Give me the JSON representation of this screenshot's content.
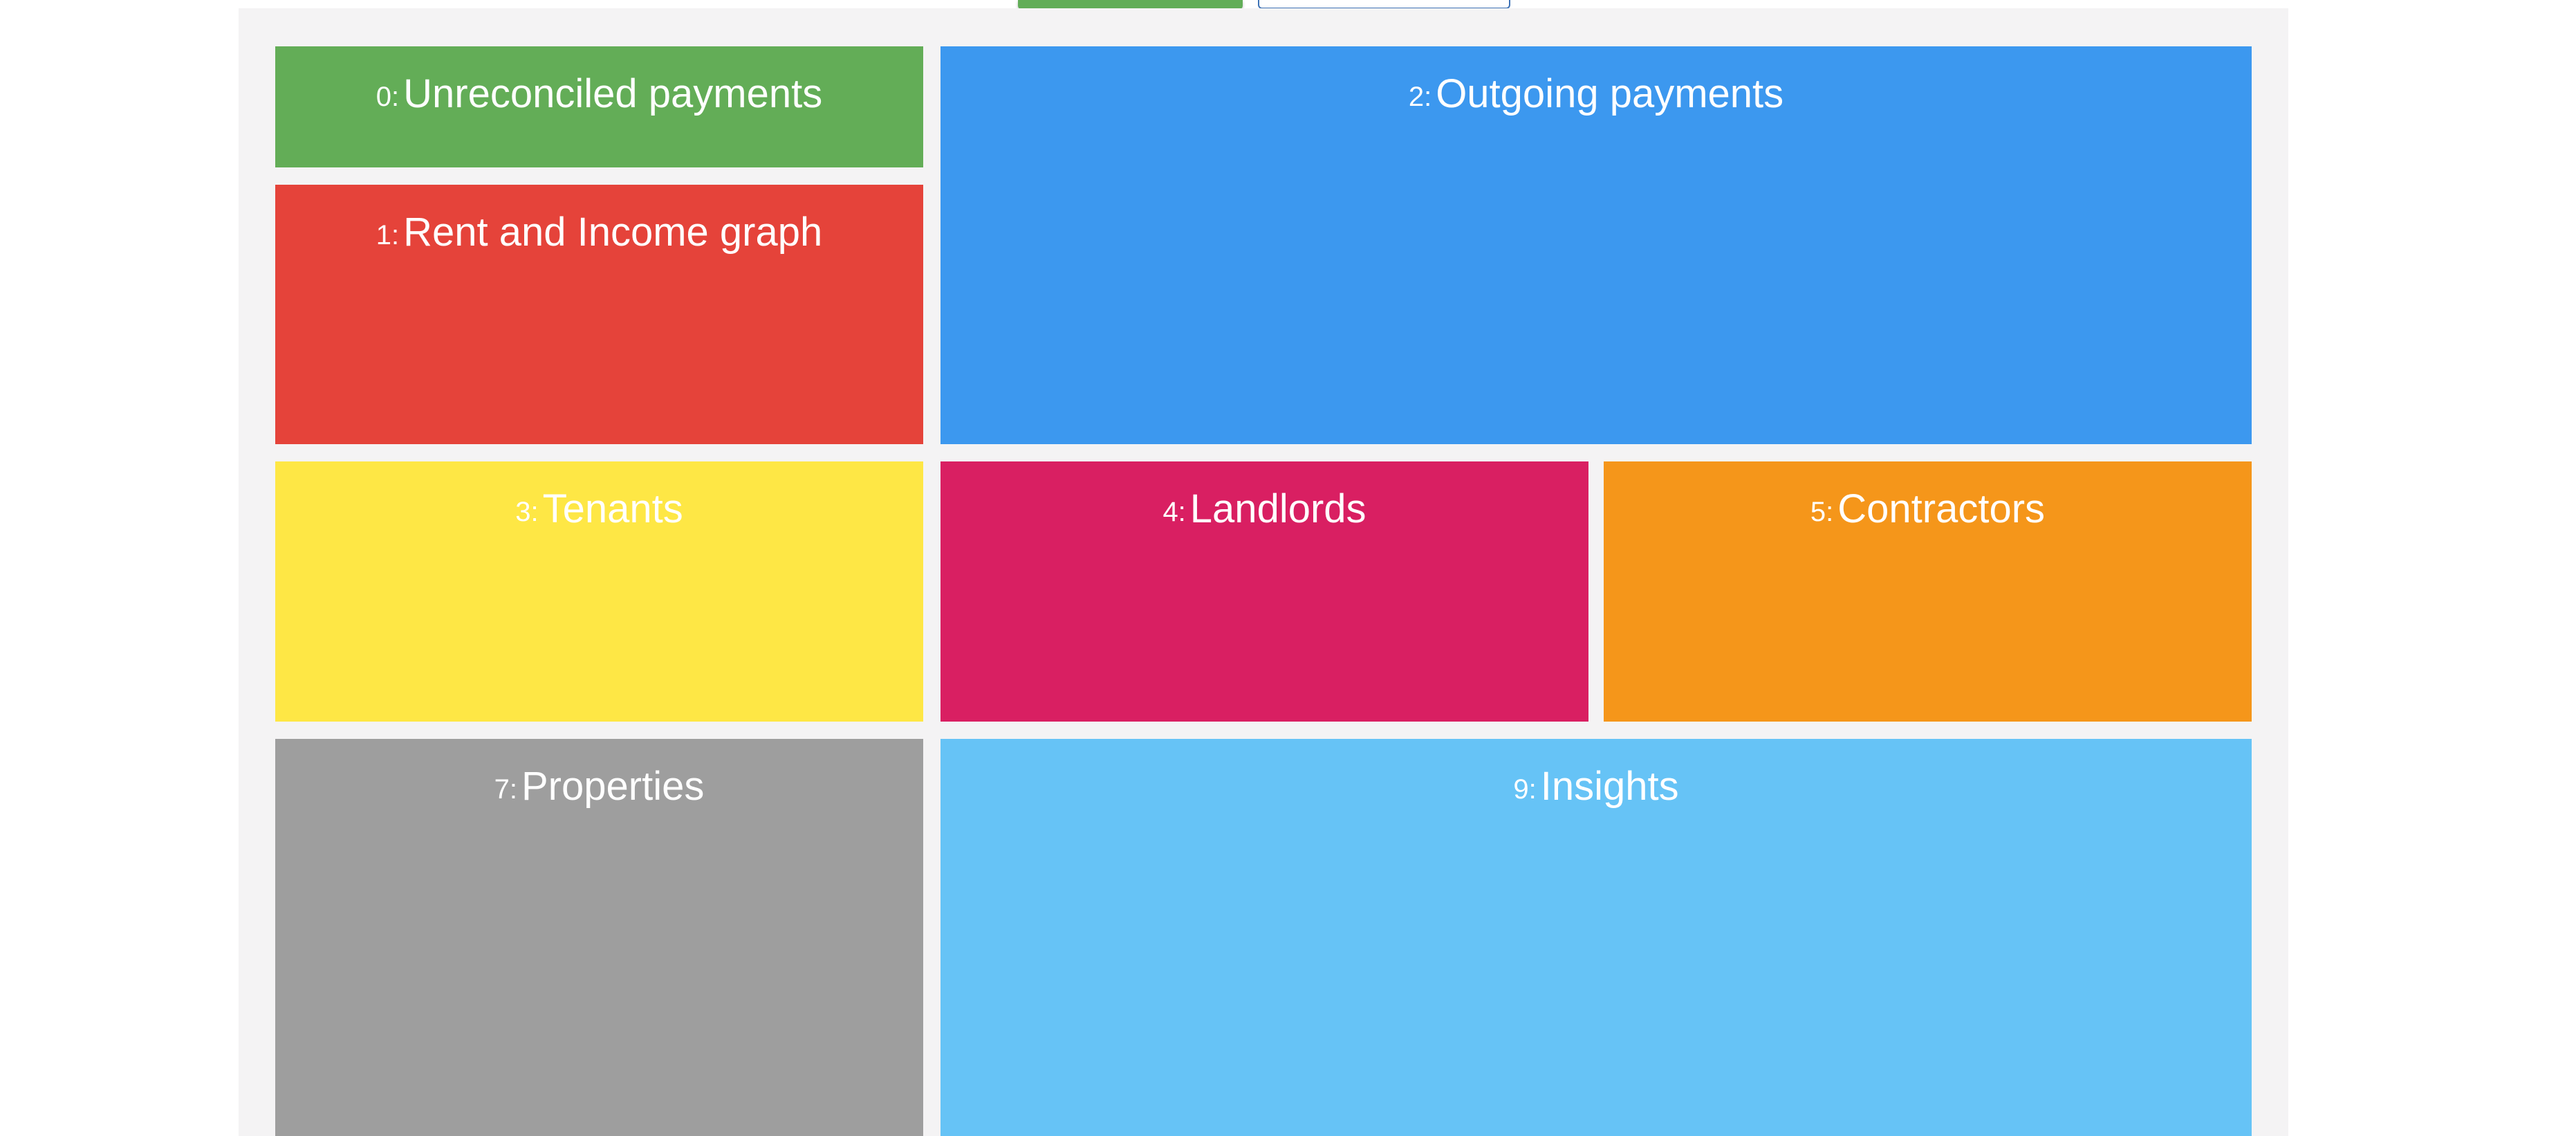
{
  "toolbar": {
    "primary_button_color": "#62ad58",
    "secondary_button_border_color": "#3f73b6"
  },
  "tiles": [
    {
      "index": "0:",
      "name": "Unreconciled payments",
      "color": "#63ad57"
    },
    {
      "index": "1:",
      "name": "Rent and Income graph",
      "color": "#e5433a"
    },
    {
      "index": "2:",
      "name": "Outgoing payments",
      "color": "#3c98ef"
    },
    {
      "index": "3:",
      "name": "Tenants",
      "color": "#fee745"
    },
    {
      "index": "4:",
      "name": "Landlords",
      "color": "#d91f62"
    },
    {
      "index": "5:",
      "name": "Contractors",
      "color": "#f5961a"
    },
    {
      "index": "7:",
      "name": "Properties",
      "color": "#9e9e9e"
    },
    {
      "index": "9:",
      "name": "Insights",
      "color": "#66c3f6"
    }
  ]
}
